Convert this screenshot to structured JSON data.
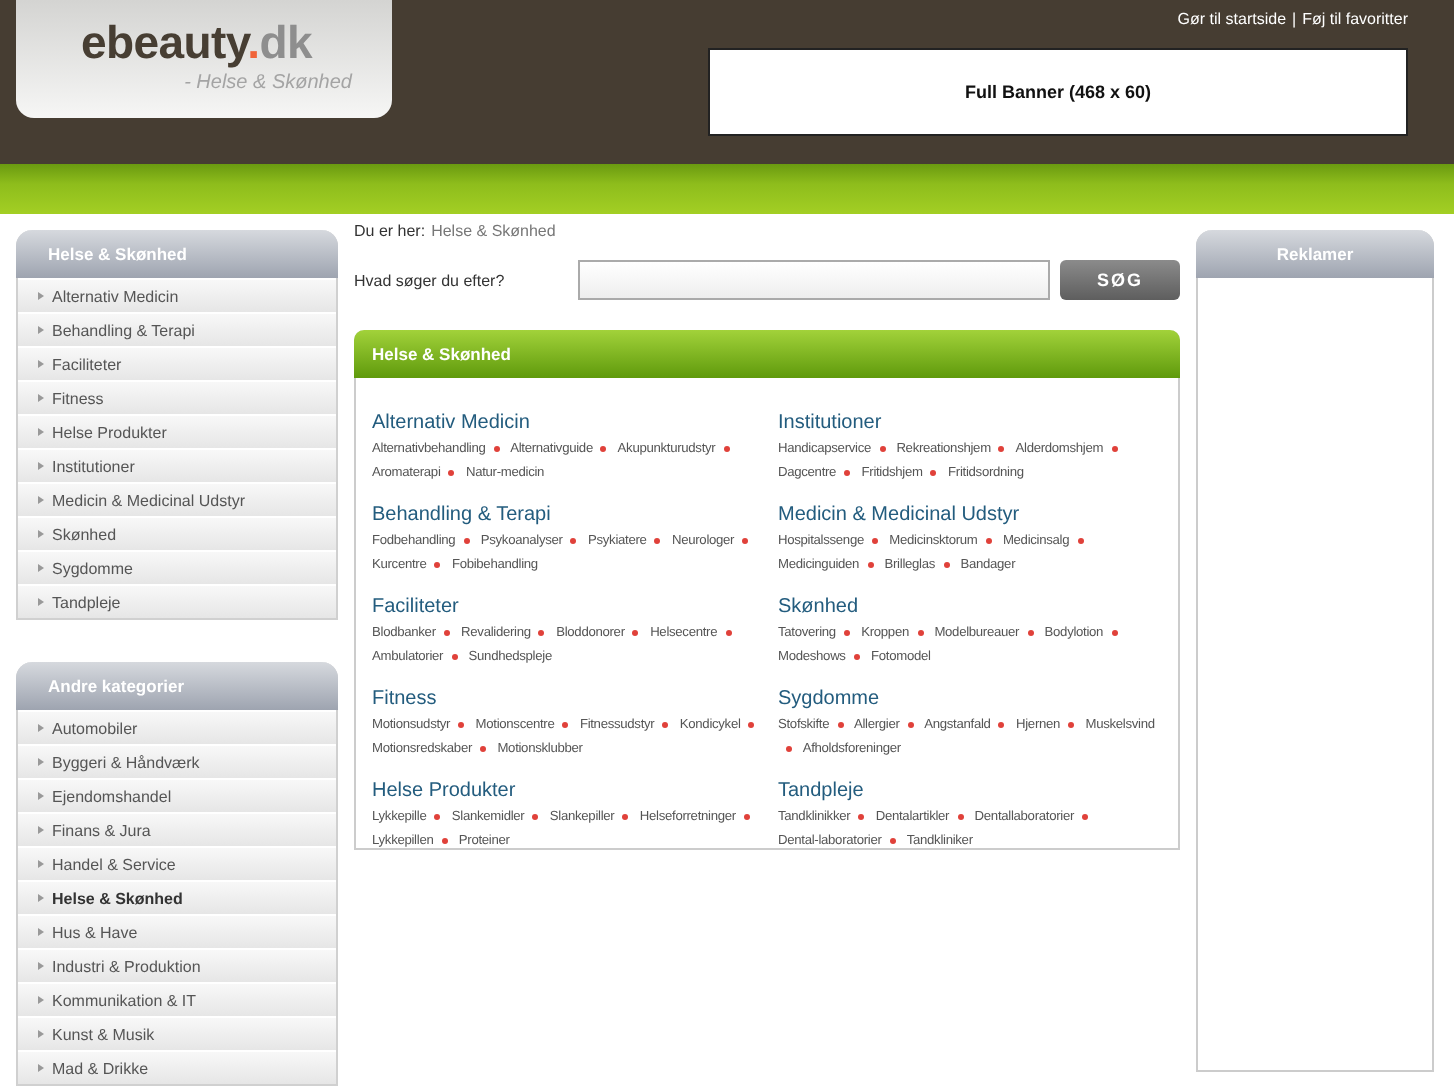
{
  "header": {
    "logo": {
      "name": "ebeauty",
      "dot": ".",
      "tld": "dk"
    },
    "tagline": "- Helse & Skønhed",
    "top_links": [
      "Gør til startside",
      "Føj til favoritter"
    ],
    "link_separator": "|",
    "banner": "Full Banner (468 x 60)"
  },
  "breadcrumb": {
    "label": "Du er her:",
    "current": "Helse & Skønhed"
  },
  "search": {
    "label": "Hvad søger du efter?",
    "button": "SØG"
  },
  "sidebar": [
    {
      "title": "Helse & Skønhed",
      "items": [
        {
          "label": "Alternativ Medicin",
          "selected": false
        },
        {
          "label": "Behandling & Terapi",
          "selected": false
        },
        {
          "label": "Faciliteter",
          "selected": false
        },
        {
          "label": "Fitness",
          "selected": false
        },
        {
          "label": "Helse Produkter",
          "selected": false
        },
        {
          "label": "Institutioner",
          "selected": false
        },
        {
          "label": "Medicin & Medicinal Udstyr",
          "selected": false
        },
        {
          "label": "Skønhed",
          "selected": false
        },
        {
          "label": "Sygdomme",
          "selected": false
        },
        {
          "label": "Tandpleje",
          "selected": false
        }
      ]
    },
    {
      "title": "Andre kategorier",
      "items": [
        {
          "label": "Automobiler",
          "selected": false
        },
        {
          "label": "Byggeri & Håndværk",
          "selected": false
        },
        {
          "label": "Ejendomshandel",
          "selected": false
        },
        {
          "label": "Finans & Jura",
          "selected": false
        },
        {
          "label": "Handel & Service",
          "selected": false
        },
        {
          "label": "Helse & Skønhed",
          "selected": true
        },
        {
          "label": "Hus & Have",
          "selected": false
        },
        {
          "label": "Industri & Produktion",
          "selected": false
        },
        {
          "label": "Kommunikation & IT",
          "selected": false
        },
        {
          "label": "Kunst & Musik",
          "selected": false
        },
        {
          "label": "Mad & Drikke",
          "selected": false
        }
      ]
    }
  ],
  "panel": {
    "title": "Helse & Skønhed",
    "columns": [
      [
        {
          "title": "Alternativ Medicin",
          "links": [
            "Alternativbehandling",
            "Alternativguide",
            "Akupunkturudstyr",
            "Aromaterapi",
            "Natur-medicin"
          ]
        },
        {
          "title": "Behandling & Terapi",
          "links": [
            "Fodbehandling",
            "Psykoanalyser",
            "Psykiatere",
            "Neurologer",
            "Kurcentre",
            "Fobibehandling"
          ]
        },
        {
          "title": "Faciliteter",
          "links": [
            "Blodbanker",
            "Revalidering",
            "Bloddonorer",
            "Helsecentre",
            "Ambulatorier",
            "Sundhedspleje"
          ]
        },
        {
          "title": "Fitness",
          "links": [
            "Motionsudstyr",
            "Motionscentre",
            "Fitnessudstyr",
            "Kondicykel",
            "Motionsredskaber",
            "Motionsklubber"
          ]
        },
        {
          "title": "Helse Produkter",
          "links": [
            "Lykkepille",
            "Slankemidler",
            "Slankepiller",
            "Helseforretninger",
            "Lykkepillen",
            "Proteiner"
          ]
        }
      ],
      [
        {
          "title": "Institutioner",
          "links": [
            "Handicapservice",
            "Rekreationshjem",
            "Alderdomshjem",
            "Dagcentre",
            "Fritidshjem",
            "Fritidsordning"
          ]
        },
        {
          "title": "Medicin & Medicinal Udstyr",
          "links": [
            "Hospitalssenge",
            "Medicinsktorum",
            "Medicinsalg",
            "Medicinguiden",
            "Brilleglas",
            "Bandager"
          ]
        },
        {
          "title": "Skønhed",
          "links": [
            "Tatovering",
            "Kroppen",
            "Modelbureauer",
            "Bodylotion",
            "Modeshows",
            "Fotomodel"
          ]
        },
        {
          "title": "Sygdomme",
          "links": [
            "Stofskifte",
            "Allergier",
            "Angstanfald",
            "Hjernen",
            "Muskelsvind",
            "Afholdsforeninger"
          ]
        },
        {
          "title": "Tandpleje",
          "links": [
            "Tandklinikker",
            "Dentalartikler",
            "Dentallaboratorier",
            "Dental-laboratorier",
            "Tandkliniker"
          ]
        }
      ]
    ]
  },
  "ads": {
    "title": "Reklamer"
  }
}
